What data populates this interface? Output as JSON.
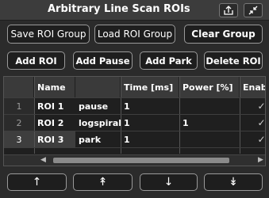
{
  "window": {
    "title": "Arbitrary Line Scan ROIs",
    "icons": [
      "export-icon",
      "collapse-icon"
    ]
  },
  "toolbar_top": {
    "save_label": "Save ROI Group",
    "load_label": "Load ROI Group",
    "clear_label": "Clear Group"
  },
  "toolbar_mid": {
    "add_roi_label": "Add ROI",
    "add_pause_label": "Add Pause",
    "add_park_label": "Add Park",
    "delete_roi_label": "Delete ROI"
  },
  "table": {
    "columns": [
      "Name",
      "",
      "Time [ms]",
      "Power [%]",
      "Enabl"
    ],
    "rows": [
      {
        "num": "1",
        "name": "ROI 1",
        "type": "pause",
        "time": "1",
        "power": "",
        "enabled": true
      },
      {
        "num": "2",
        "name": "ROI 2",
        "type": "logspiral",
        "time": "1",
        "power": "1",
        "enabled": true
      },
      {
        "num": "3",
        "name": "ROI 3",
        "type": "park",
        "time": "1",
        "power": "",
        "enabled": true
      }
    ],
    "selected_row": 3
  },
  "toolbar_bottom": {
    "move_top_glyph": "↑",
    "move_up_glyph": "↟",
    "move_down_glyph": "↓",
    "move_bottom_glyph": "↡"
  }
}
